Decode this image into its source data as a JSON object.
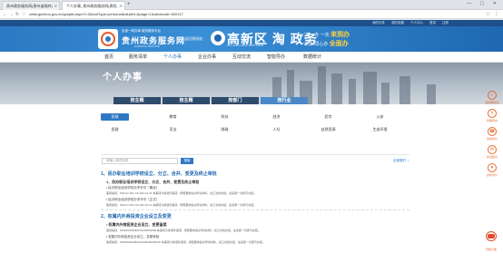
{
  "browser": {
    "tabs": [
      {
        "title": "贵州政务服务网(贵州省政府)"
      },
      {
        "title": "个人办事_贵州政务服务网(贵阳...",
        "active": true
      }
    ],
    "new_tab": "+",
    "window_controls": "— ▢ ✕",
    "url": "zwfw.guizhou.gov.cn/gzlqlist.aspx?i=3&sortType=personal&deptId=&page=1&areacode=520117"
  },
  "page": {
    "top_links": [
      "我的办件",
      "我的收藏",
      "个人中心",
      "登录",
      "注册"
    ],
    "site": {
      "sub": "全省一网办事 政务服务平台",
      "title": "贵州政务服务网",
      "en": "GUIZHOU SERVICE",
      "back_home": "◂ 返回贵阳站"
    },
    "district": {
      "title": "高新区 淘 政务",
      "sub": "GUIYANG HIGH-TECH ZONE",
      "slogan_1a": "一次一 办 一次",
      "slogan_1b": "来到办",
      "slogan_2a": "一次办 同心办",
      "slogan_2b": "全面办"
    },
    "nav": [
      "首页",
      "服务清单",
      "个人办事",
      "企业办事",
      "互动交流",
      "智能导办",
      "数据统计"
    ],
    "nav_active": 2,
    "hero_title": "个人办事",
    "tabs": [
      "按主题",
      "按主题",
      "按部门",
      "按行业"
    ],
    "tabs_active": 3,
    "categories_row1": [
      "民政",
      "教育",
      "科技",
      "经济",
      "民宗",
      "公安"
    ],
    "categories_row2": [
      "民政",
      "司法",
      "财政",
      "人社",
      "自然资源",
      "生态环境"
    ],
    "category_active": 0,
    "search": {
      "placeholder": "请输入事项名称",
      "button": "搜索",
      "filter": "全部展开 ⌄"
    },
    "sections": [
      {
        "title": "1、民办职业培训学校设立、分立、合并、变更及终止审批",
        "sub": "1、民办职业培训学校设立、分立、合并、变更及终止审批",
        "items": [
          {
            "name": "• 民办职业培训学校办学许可（筹设）",
            "code": "事项编码：520117-001-XK-002-01-01  本事项为承诺件事项，按照要求提交申请材料，窗口当场办结，最多跑一次即可办结。"
          },
          {
            "name": "• 民办职业培训学校办学许可（正式）",
            "code": "事项编码：520117-001-XK-002-02-01  本事项为承诺件事项，按照要求提交申请材料，窗口当场办结，最多跑一次即可办结。"
          }
        ]
      },
      {
        "title": "2、权属内外商投资企业设立及变更",
        "sub": "• 权属内外商投资企业设立、变更备案",
        "items": [
          {
            "name": "",
            "code": "事项编码：520000200280201000503058  本事项为承诺件事项，按照要求提交申请材料，窗口当场办结，最多跑一次即可办结。"
          },
          {
            "name": "• 权属内外商投资企业设立、变更审批",
            "code": "事项编码：520000200280201000180403625  本事项为承诺件事项，按照要求提交申请材料，窗口当场办结，最多跑一次即可办结。"
          }
        ]
      }
    ],
    "sidebar": [
      {
        "icon": "⌂",
        "label": "我的服务库"
      },
      {
        "icon": "✎",
        "label": "智能导办"
      },
      {
        "icon": "☎",
        "label": "咨询评价"
      },
      {
        "icon": "✉",
        "label": "投诉建议"
      },
      {
        "icon": "♥",
        "label": "办件评价"
      }
    ],
    "robot_label": "智能小助"
  }
}
